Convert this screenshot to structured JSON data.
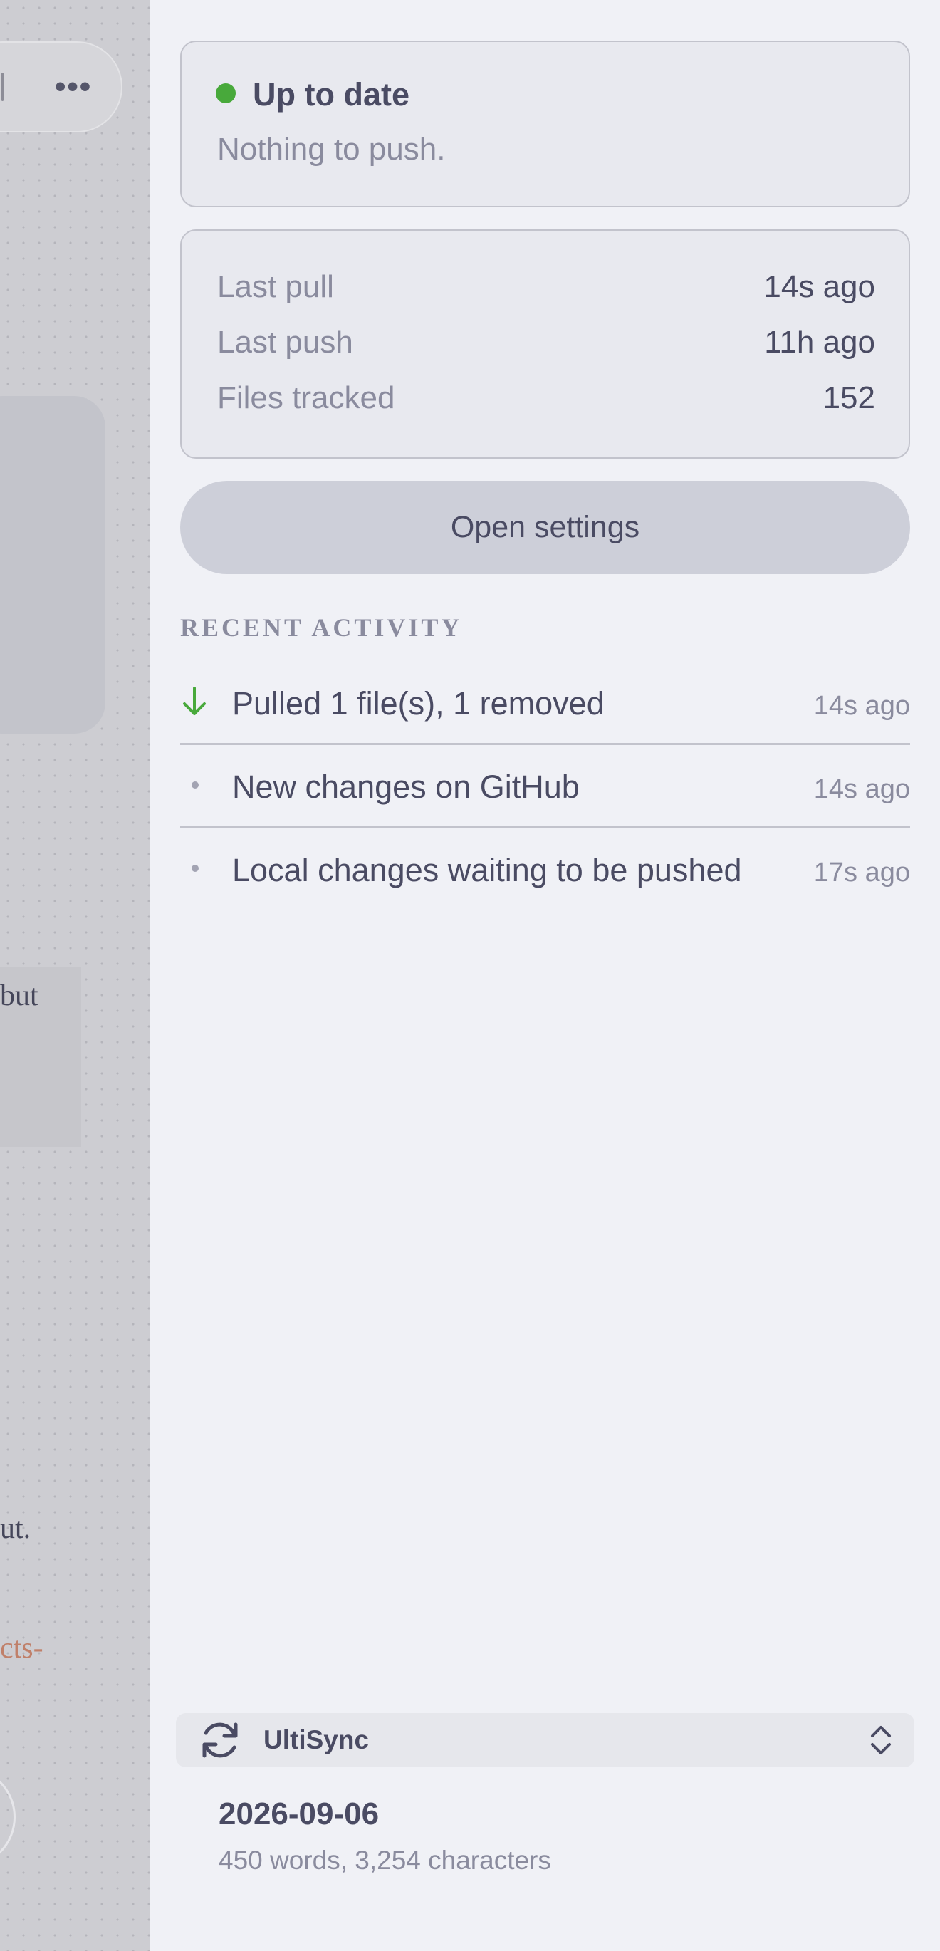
{
  "editor_background": {
    "fragments": [
      "but",
      "ut.",
      "cts-"
    ],
    "more_icon_name": "ellipsis-icon"
  },
  "status": {
    "title": "Up to date",
    "subtitle": "Nothing to push.",
    "color": "#48a93b"
  },
  "stats": [
    {
      "label": "Last pull",
      "value": "14s ago"
    },
    {
      "label": "Last push",
      "value": "11h ago"
    },
    {
      "label": "Files tracked",
      "value": "152"
    }
  ],
  "settings_button": {
    "label": "Open settings"
  },
  "recent_activity": {
    "heading": "RECENT ACTIVITY",
    "items": [
      {
        "icon": "arrow-down-icon",
        "text": "Pulled 1 file(s), 1 removed",
        "time": "14s ago"
      },
      {
        "icon": "bullet-dot-icon",
        "text": "New changes on GitHub",
        "time": "14s ago"
      },
      {
        "icon": "bullet-dot-icon",
        "text": "Local changes waiting to be pushed",
        "time": "17s ago"
      }
    ]
  },
  "plugin_selector": {
    "icon": "sync-icon",
    "name": "UltiSync",
    "chevron_icon": "chevron-up-down-icon"
  },
  "note": {
    "date": "2026-09-06",
    "stats": "450 words, 3,254 characters"
  }
}
